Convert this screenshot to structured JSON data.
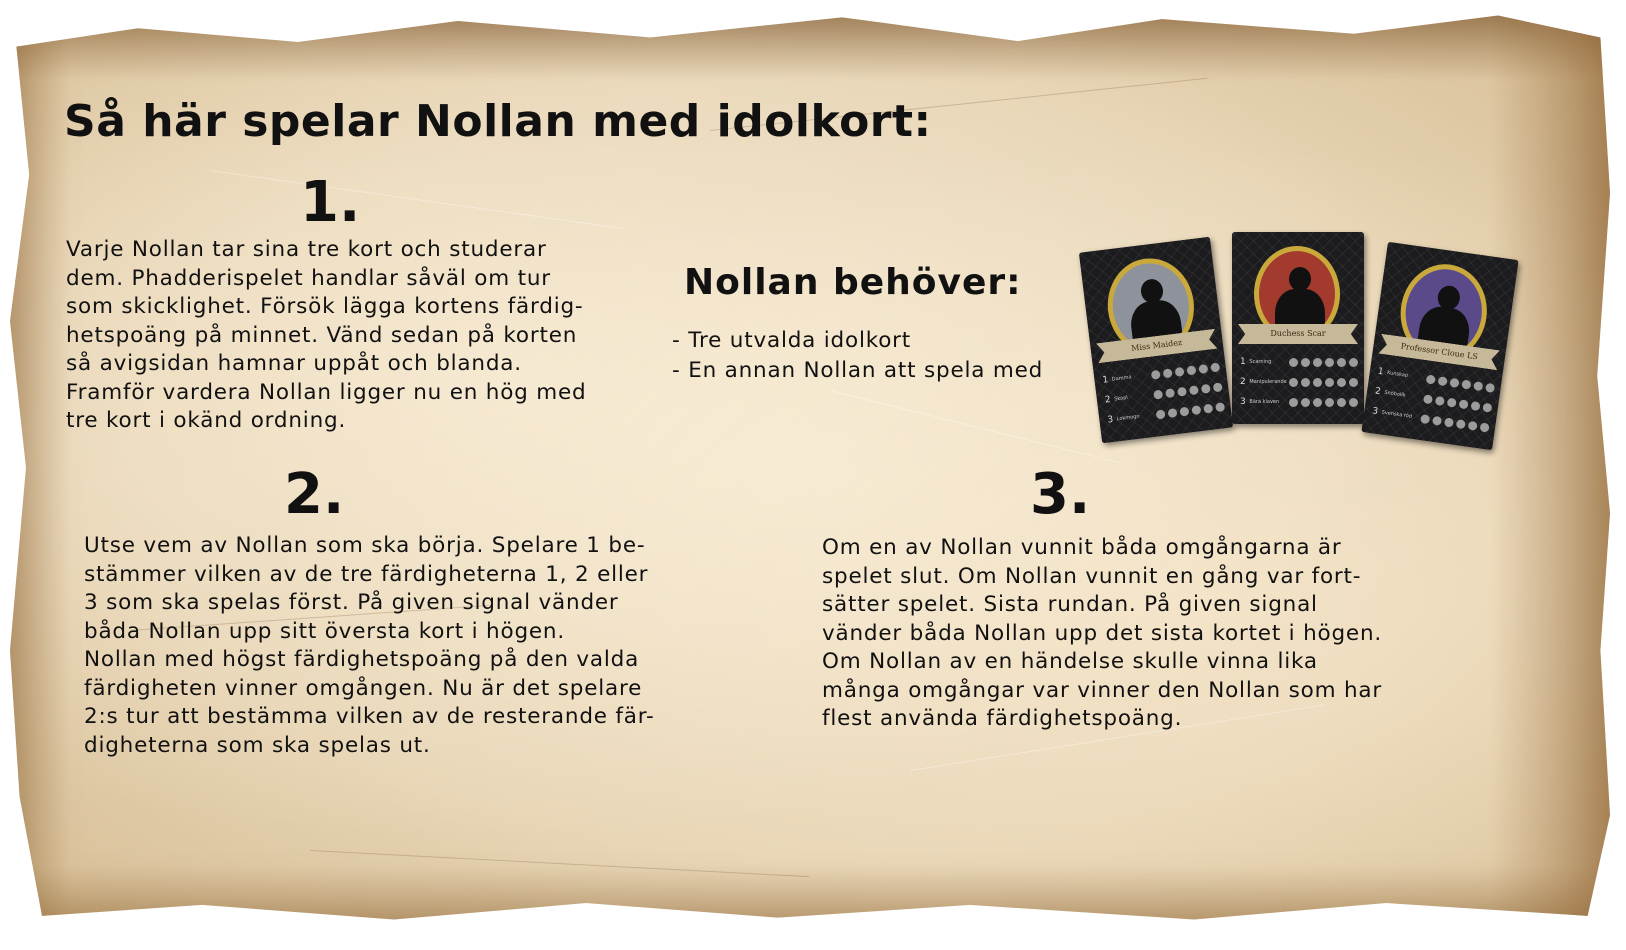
{
  "title": "Så här spelar Nollan med idolkort:",
  "steps": [
    {
      "number": "1.",
      "lines": [
        "Varje Nollan tar sina tre kort och studerar",
        "dem. Phadderispelet handlar såväl om tur",
        "som skicklighet. Försök lägga kortens färdig-",
        "hetspoäng på minnet. Vänd sedan på korten",
        "så avigsidan hamnar uppåt och blanda.",
        "Framför vardera Nollan ligger nu en hög med",
        "tre kort i okänd ordning."
      ]
    },
    {
      "number": "2.",
      "lines": [
        "Utse vem av Nollan som ska börja. Spelare 1 be-",
        "stämmer vilken av de tre färdigheterna 1, 2 eller",
        "3 som ska spelas först. På given signal vänder",
        "båda Nollan upp sitt översta kort i högen.",
        "Nollan med högst färdighetspoäng på den valda",
        "färdigheten vinner omgången. Nu är det spelare",
        "2:s tur att bestämma vilken av de resterande fär-",
        "digheterna som ska spelas ut."
      ]
    },
    {
      "number": "3.",
      "lines": [
        "Om en av Nollan vunnit båda omgångarna är",
        "spelet slut. Om Nollan vunnit en gång var fort-",
        "sätter spelet. Sista rundan. På given signal",
        "vänder båda Nollan upp det sista kortet i högen.",
        "Om Nollan av en händelse skulle vinna lika",
        "många omgångar var vinner den Nollan som har",
        "flest använda färdighetspoäng."
      ]
    }
  ],
  "needs": {
    "heading": "Nollan behöver:",
    "items": [
      "- Tre utvalda idolkort",
      "- En annan Nollan att spela med"
    ]
  },
  "cards": [
    {
      "name": "Miss Maidez",
      "rows": [
        [
          "1",
          "Damma",
          [
            3,
            2,
            2
          ]
        ],
        [
          "2",
          "Skopl",
          [
            3,
            3,
            3
          ]
        ],
        [
          "3",
          "Lokmogn",
          [
            1,
            3,
            3
          ]
        ]
      ],
      "oval_color": "#8e939b"
    },
    {
      "name": "Duchess Scar",
      "rows": [
        [
          "1",
          "Scarning",
          [
            3,
            3,
            3
          ]
        ],
        [
          "2",
          "Manipulerande",
          [
            3,
            3,
            3
          ]
        ],
        [
          "3",
          "Bära klaven",
          [
            3,
            3,
            3
          ]
        ]
      ],
      "oval_color": "#a33a2e"
    },
    {
      "name": "Professor Cloue LS",
      "rows": [
        [
          "1",
          "Kunskap",
          [
            3,
            2,
            2
          ]
        ],
        [
          "2",
          "Snöbollk",
          [
            3,
            3,
            3
          ]
        ],
        [
          "3",
          "Svenska röd",
          [
            3,
            3,
            3
          ]
        ]
      ],
      "oval_color": "#5a4a8a"
    }
  ],
  "colors": {
    "paper": "#e9d9bb",
    "text": "#111111",
    "card_background": "#1c1c1e",
    "card_frame": "#c9a93b",
    "card_banner": "#c6b99a"
  }
}
